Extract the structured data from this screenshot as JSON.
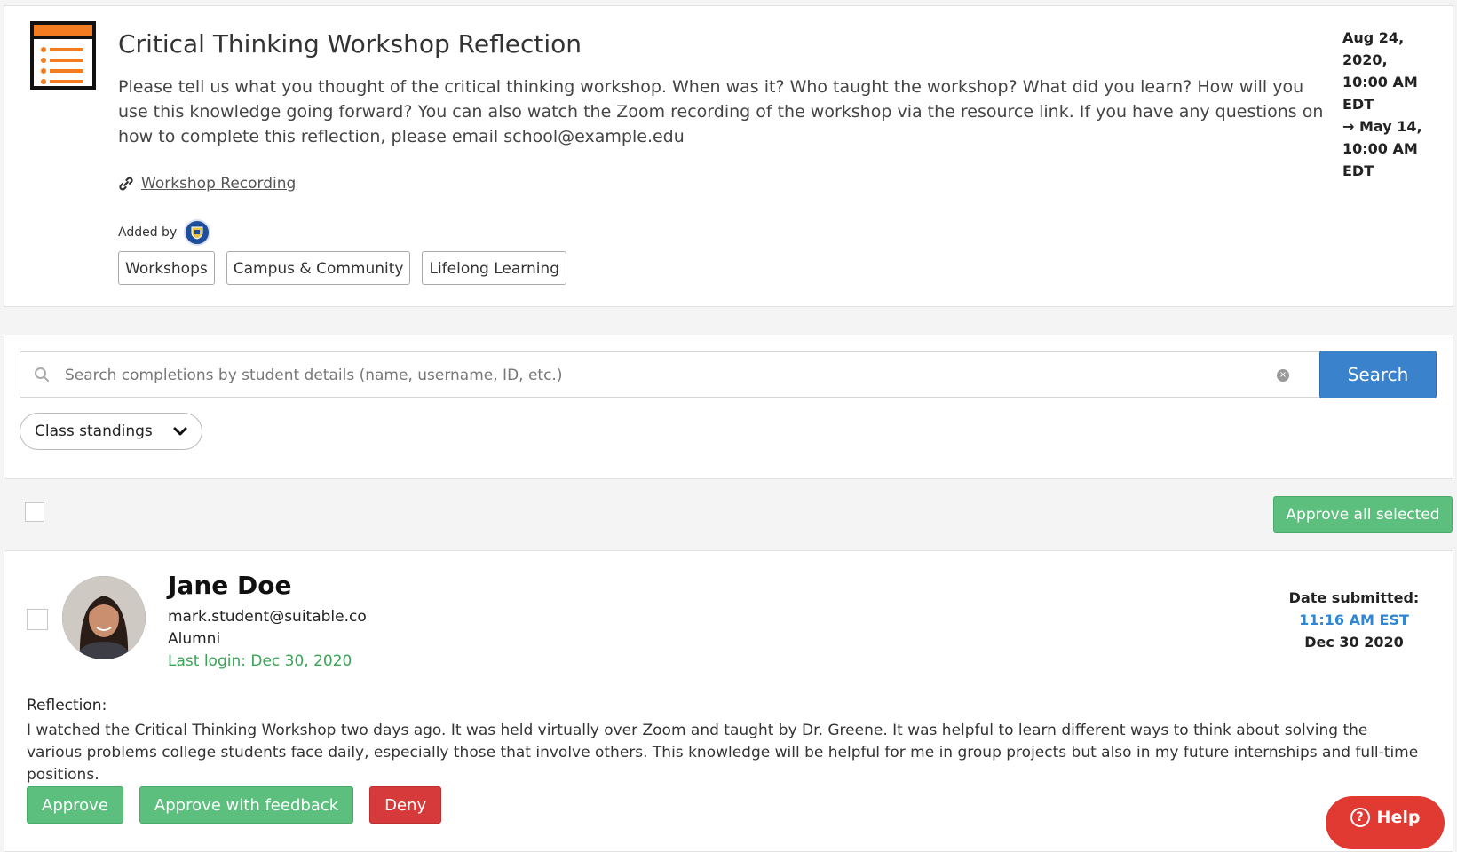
{
  "experience": {
    "title": "Critical Thinking Workshop Reflection",
    "description": "Please tell us what you thought of the critical thinking workshop. When was it? Who taught the workshop? What did you learn? How will you use this knowledge going forward? You can also watch the Zoom recording of the workshop via the resource link. If you have any questions on how to complete this reflection, please email school@example.edu",
    "resource_link": "Workshop Recording",
    "added_by_label": "Added by",
    "tags": [
      "Workshops",
      "Campus & Community",
      "Lifelong Learning"
    ],
    "date_range": {
      "start": "Aug 24, 2020, 10:00 AM EDT",
      "end": "May 14, 10:00 AM EDT"
    },
    "colors": {
      "icon_accent": "#f47c20",
      "icon_frame": "#111111"
    }
  },
  "search": {
    "placeholder": "Search completions by student details (name, username, ID, etc.)",
    "button_label": "Search",
    "filter_label": "Class standings"
  },
  "bulk": {
    "approve_all_label": "Approve all selected"
  },
  "submission": {
    "name": "Jane Doe",
    "email": "mark.student@suitable.co",
    "standing": "Alumni",
    "last_login": "Last login: Dec 30, 2020",
    "date_submitted_label": "Date submitted:",
    "time": "11:16 AM EST",
    "date": "Dec 30 2020",
    "reflection_label": "Reflection:",
    "reflection_text": "I watched the Critical Thinking Workshop two days ago. It was held virtually over Zoom and taught by Dr. Greene. It was helpful to learn different ways to think about solving the various problems college students face daily, especially those that involve others. This knowledge will be helpful for me in group projects but also in my future internships and full-time positions.",
    "actions": {
      "approve": "Approve",
      "approve_feedback": "Approve with feedback",
      "deny": "Deny"
    }
  },
  "help": {
    "label": "Help"
  },
  "colors": {
    "primary_blue": "#3b82cc",
    "approve_green": "#5cbf7e",
    "deny_red": "#d63a3a",
    "login_green": "#3aa356",
    "help_red": "#e03a33"
  }
}
